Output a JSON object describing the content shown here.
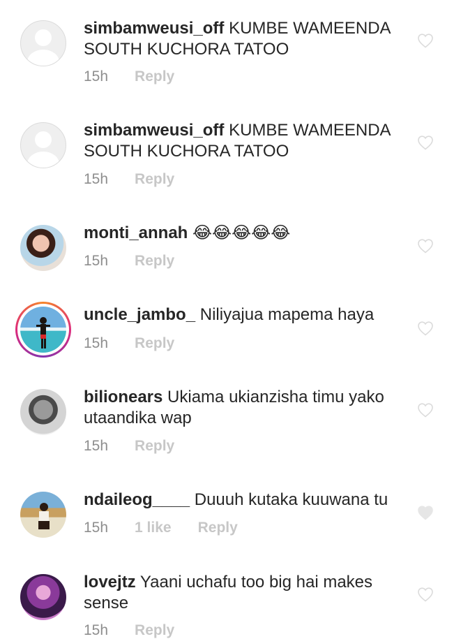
{
  "comments": [
    {
      "username": "simbamweusi_off",
      "text": "KUMBE WAMEENDA SOUTH KUCHORA TATOO",
      "time": "15h",
      "likes": "",
      "reply": "Reply",
      "liked": false
    },
    {
      "username": "simbamweusi_off",
      "text": "KUMBE WAMEENDA SOUTH KUCHORA TATOO",
      "time": "15h",
      "likes": "",
      "reply": "Reply",
      "liked": false
    },
    {
      "username": "monti_annah",
      "text": "😂😂😂😂😂",
      "time": "15h",
      "likes": "",
      "reply": "Reply",
      "liked": false
    },
    {
      "username": "uncle_jambo_",
      "text": "Niliyajua mapema haya",
      "time": "15h",
      "likes": "",
      "reply": "Reply",
      "liked": false
    },
    {
      "username": "bilionears",
      "text": "Ukiama ukianzisha timu yako utaandika wap",
      "time": "15h",
      "likes": "",
      "reply": "Reply",
      "liked": false
    },
    {
      "username": "ndaileog____",
      "text": "Duuuh kutaka kuuwana tu",
      "time": "15h",
      "likes": "1 like",
      "reply": "Reply",
      "liked": true
    },
    {
      "username": "lovejtz",
      "text": "Yaani uchafu too big hai makes sense",
      "time": "15h",
      "likes": "",
      "reply": "Reply",
      "liked": false
    }
  ],
  "colors": {
    "text": "#262626",
    "meta": "#8e8e8e",
    "reply": "#c7c7c7",
    "heart_outline": "#dbdbdb",
    "heart_filled": "#e6e6e6",
    "story_ring": "#dd2a7b"
  }
}
